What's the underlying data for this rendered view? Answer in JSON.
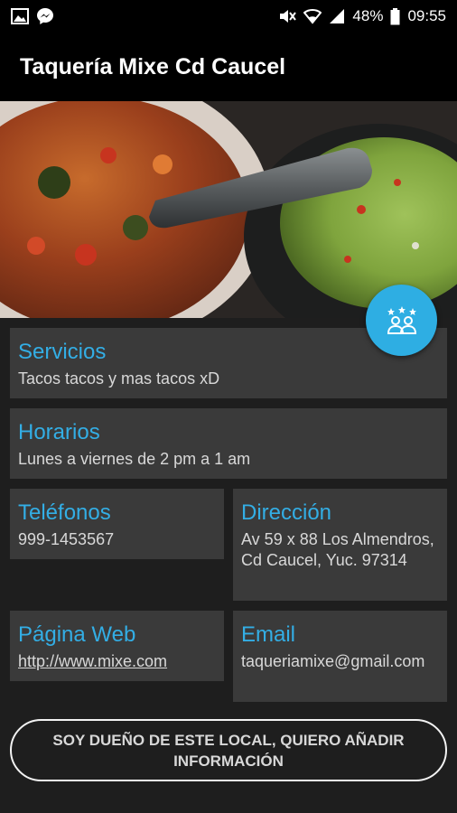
{
  "status_bar": {
    "battery": "48%",
    "time": "09:55",
    "icons_left": [
      "image-icon",
      "messenger-icon"
    ],
    "icons_right": [
      "mute-icon",
      "wifi-icon",
      "signal-icon",
      "battery-icon"
    ]
  },
  "app_bar": {
    "title": "Taquería Mixe Cd Caucel"
  },
  "cards": {
    "servicios": {
      "title": "Servicios",
      "value": "Tacos tacos y mas tacos xD"
    },
    "horarios": {
      "title": "Horarios",
      "value": "Lunes a viernes de 2 pm a 1 am"
    },
    "telefonos": {
      "title": "Teléfonos",
      "value": "999-1453567"
    },
    "direccion": {
      "title": "Dirección",
      "value": "Av  59 x 88 Los Almendros, Cd Caucel, Yuc. 97314"
    },
    "web": {
      "title": "Página Web",
      "value": "http://www.mixe.com"
    },
    "email": {
      "title": "Email",
      "value": "taqueriamixe@gmail.com"
    }
  },
  "owner_button": {
    "label": "SOY DUEÑO DE ESTE LOCAL, QUIERO AÑADIR INFORMACIÓN"
  },
  "colors": {
    "accent": "#33aee5",
    "fab": "#2eaee3",
    "card": "#3a3a3a",
    "background": "#1e1e1e"
  }
}
